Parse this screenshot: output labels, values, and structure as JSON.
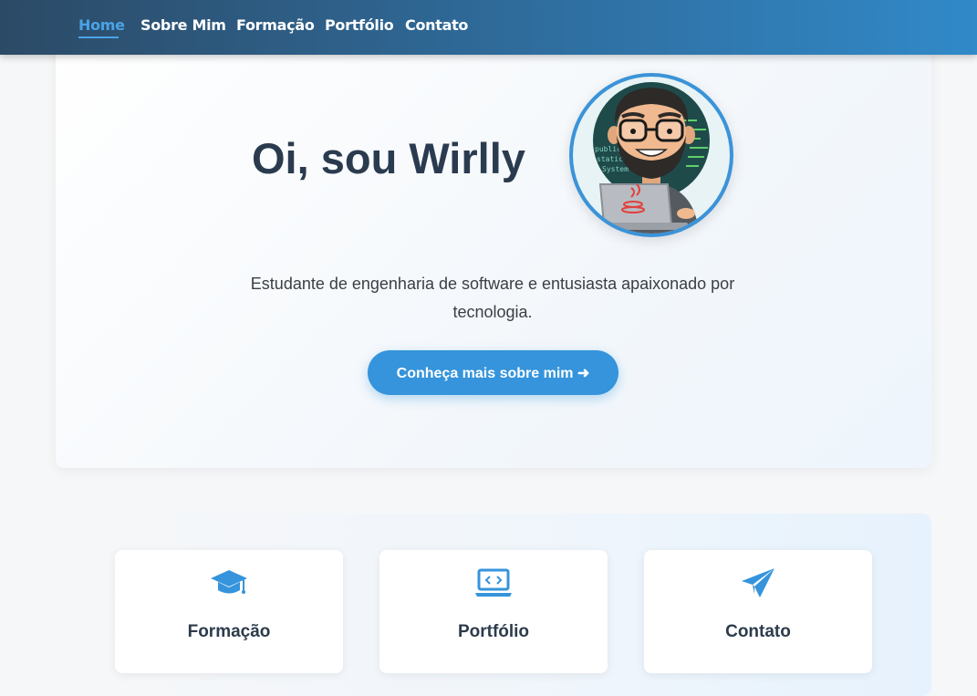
{
  "nav": {
    "items": [
      {
        "label": "Home",
        "active": true
      },
      {
        "label": "Sobre Mim",
        "active": false
      },
      {
        "label": "Formação",
        "active": false
      },
      {
        "label": "Portfólio",
        "active": false
      },
      {
        "label": "Contato",
        "active": false
      }
    ]
  },
  "hero": {
    "title": "Oi, sou Wirlly",
    "subtitle": "Estudante de engenharia de software e entusiasta apaixonado por tecnologia.",
    "cta_label": "Conheça mais sobre mim ➜",
    "avatar_code_lines": [
      "public",
      "static",
      "System"
    ]
  },
  "cards": [
    {
      "label": "Formação",
      "icon": "graduation-cap-icon"
    },
    {
      "label": "Portfólio",
      "icon": "laptop-code-icon"
    },
    {
      "label": "Contato",
      "icon": "paper-plane-icon"
    }
  ],
  "colors": {
    "accent": "#3594db",
    "nav_start": "#2c4a66",
    "nav_end": "#3189c8",
    "heading": "#2b3b4f"
  }
}
